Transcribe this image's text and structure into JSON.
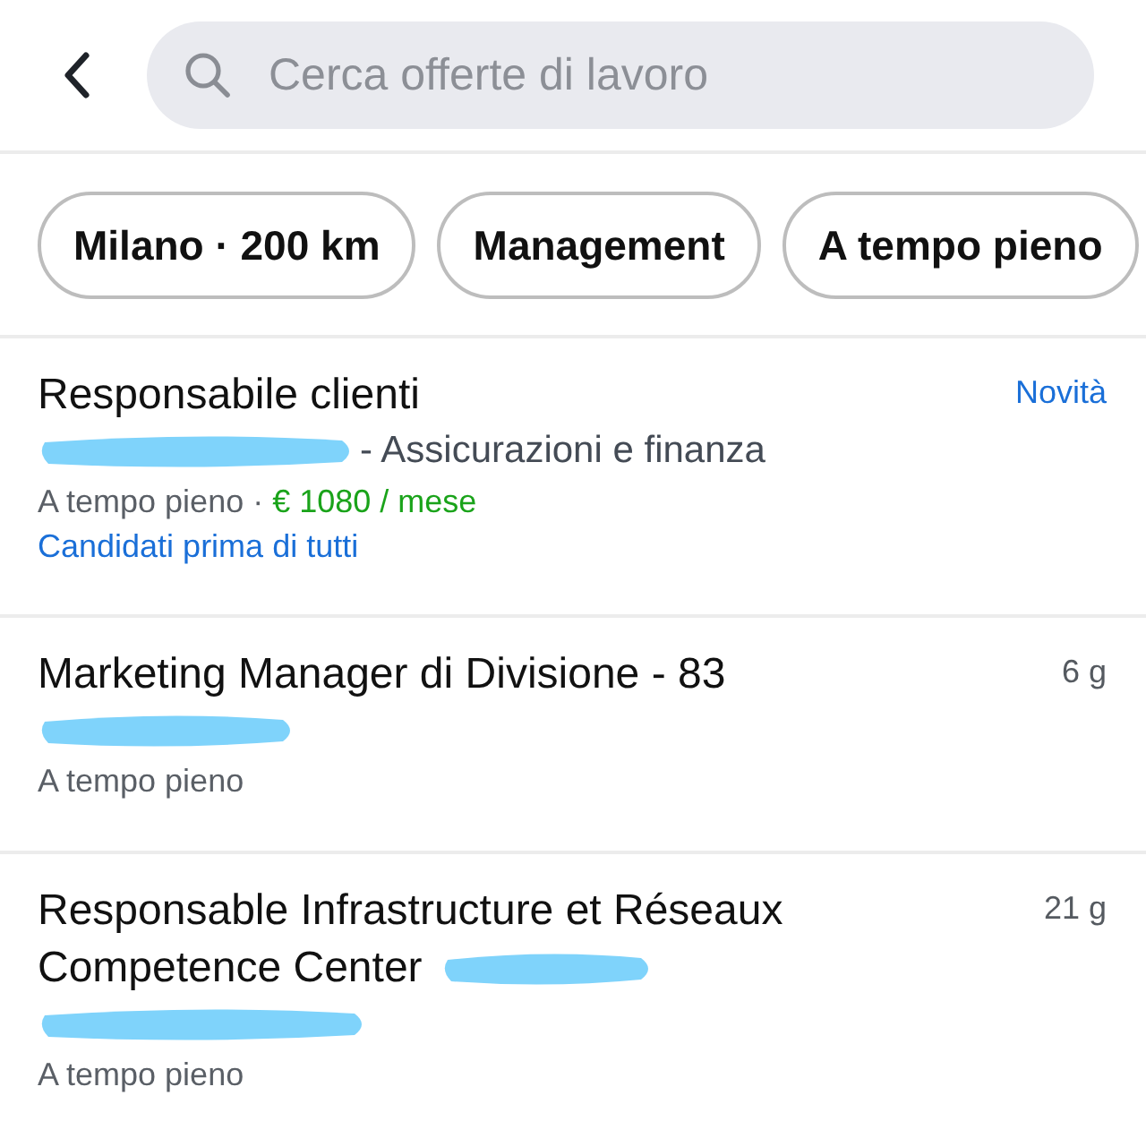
{
  "search": {
    "placeholder": "Cerca offerte di lavoro"
  },
  "filters": [
    {
      "label": "Milano · 200 km"
    },
    {
      "label": "Management"
    },
    {
      "label": "A tempo pieno"
    }
  ],
  "jobs": [
    {
      "title": "Responsabile clienti",
      "title_redacted": false,
      "company_redacted": true,
      "sector": "- Assicurazioni e finanza",
      "type": "A tempo pieno ·",
      "salary": "€ 1080 / mese",
      "promo": "Candidati prima di tutti",
      "corner": {
        "kind": "new",
        "text": "Novità"
      }
    },
    {
      "title": "Marketing Manager di Divisione - 83",
      "title_redacted": false,
      "company_redacted": true,
      "type": "A tempo pieno",
      "corner": {
        "kind": "age",
        "text": "6 g"
      }
    },
    {
      "title": "Responsable Infrastructure et Réseaux Competence Center",
      "title_redacted": true,
      "company_redacted": true,
      "type": "A tempo pieno",
      "corner": {
        "kind": "age",
        "text": "21 g"
      }
    }
  ]
}
